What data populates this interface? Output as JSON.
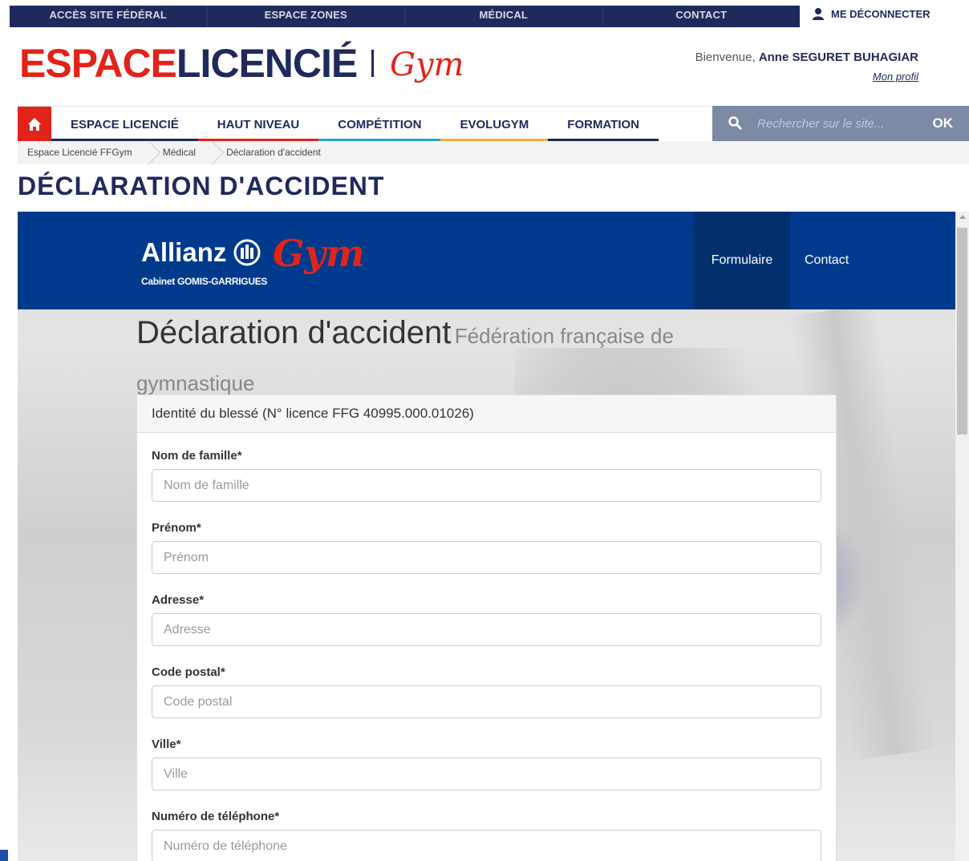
{
  "topbar": {
    "items": [
      "ACCÈS SITE FÉDÉRAL",
      "ESPACE ZONES",
      "MÉDICAL",
      "CONTACT"
    ],
    "logout_label": "ME DÉCONNECTER"
  },
  "header": {
    "logo_espace": "ESPACE",
    "logo_licencie": "LICENCIÉ",
    "logo_gym": "Gym",
    "welcome_prefix": "Bienvenue,",
    "user_name": "Anne SEGURET BUHAGIAR",
    "profile_link": "Mon profil"
  },
  "mainnav": {
    "items": [
      "ESPACE LICENCIÉ",
      "HAUT NIVEAU",
      "COMPÉTITION",
      "EVOLUGYM",
      "FORMATION"
    ],
    "search_placeholder": "Rechercher sur le site...",
    "search_button": "OK"
  },
  "breadcrumb": [
    "Espace Licencié FFGym",
    "Médical",
    "Déclaration d'accident"
  ],
  "page_title": "DÉCLARATION D'ACCIDENT",
  "frame": {
    "allianz_name": "Allianz",
    "allianz_cabinet": "Cabinet GOMIS-GARRIGUES",
    "gym_text": "Gym",
    "tabs": [
      "Formulaire",
      "Contact"
    ],
    "heading_main": "Déclaration d'accident",
    "heading_sub": "Fédération française de gymnastique",
    "panel_title": "Identité du blessé (N° licence FFG 40995.000.01026)",
    "fields": [
      {
        "label": "Nom de famille*",
        "placeholder": "Nom de famille"
      },
      {
        "label": "Prénom*",
        "placeholder": "Prénom"
      },
      {
        "label": "Adresse*",
        "placeholder": "Adresse"
      },
      {
        "label": "Code postal*",
        "placeholder": "Code postal"
      },
      {
        "label": "Ville*",
        "placeholder": "Ville"
      },
      {
        "label": "Numéro de téléphone*",
        "placeholder": "Numéro de téléphone"
      }
    ]
  },
  "colors": {
    "brand_navy": "#1f2a5c",
    "brand_red": "#e2231a",
    "allianz_blue": "#003a8c"
  }
}
